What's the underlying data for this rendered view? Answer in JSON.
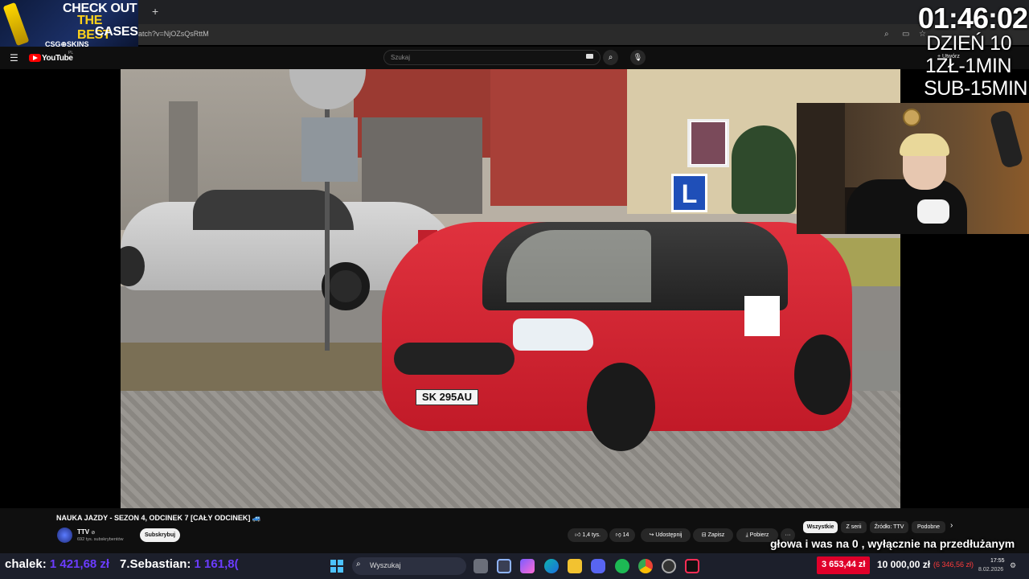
{
  "browser": {
    "url": "atch?v=NjOZsQsRttM",
    "new_tab": "+"
  },
  "promo": {
    "line1": "CHECK OUT",
    "line2": "THE BEST",
    "line3": "CASES",
    "brand": "CSG⊕SKINS"
  },
  "youtube": {
    "logo": "YouTube",
    "region": "PL",
    "search_placeholder": "Szukaj",
    "create_label": "Utwórz"
  },
  "overlay": {
    "timer": "01:46:02",
    "day": "DZIEŃ 10",
    "rate1": "1ZŁ-1MIN",
    "rate2": "SUB-15MIN"
  },
  "video_scene": {
    "plate": "SK 295AU",
    "roof_sign": "L"
  },
  "video": {
    "title": "NAUKA JAZDY - SEZON 4, ODCINEK 7 [CAŁY ODCINEK] 🚙",
    "channel": "TTV",
    "verified": "⊘",
    "subscribers": "692 tys. subskrybentów",
    "subscribe": "Subskrybuj",
    "likes": "1,4 tys.",
    "dislikes": "14",
    "share": "Udostępnij",
    "save": "Zapisz",
    "download": "Pobierz",
    "more": "···"
  },
  "chips": [
    "Wszystkie",
    "Z serii",
    "Źródło: TTV",
    "Podobne"
  ],
  "subtitle": "głowa i was na 0 , wyłącznie na przedłużanym",
  "ticker": [
    {
      "name": "chalek:",
      "amount": "1 421,68 zł"
    },
    {
      "name": "7.Sebastian:",
      "amount": "1 161,8("
    }
  ],
  "taskbar": {
    "search": "Wyszukaj",
    "donation": "3 653,44 zł",
    "goal": "10 000,00 zł",
    "goal_extra": "(6 346,56 zł)",
    "time": "17:55",
    "date": "8.02.2026"
  },
  "colors": {
    "youtube_red": "#ff0000",
    "ticker_amount": "#6b3cff",
    "donation_red": "#e0002a",
    "car_red": "#d4202e"
  }
}
